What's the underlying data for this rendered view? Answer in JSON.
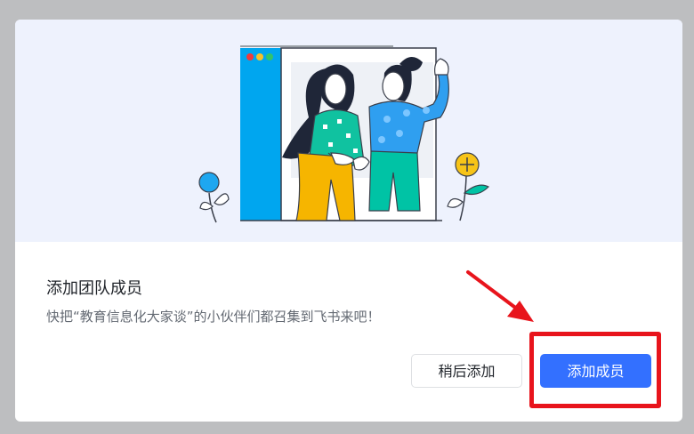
{
  "dialog": {
    "title": "添加团队成员",
    "subtitle": "快把“教育信息化大家谈”的小伙伴们都召集到飞书来吧！",
    "buttons": {
      "later_label": "稍后添加",
      "add_label": "添加成员"
    }
  },
  "colors": {
    "primary": "#3370ff",
    "annotation": "#e8141c",
    "hero_background": "#eef2fd"
  },
  "icons": [
    "team-illustration",
    "annotation-arrow-icon"
  ]
}
